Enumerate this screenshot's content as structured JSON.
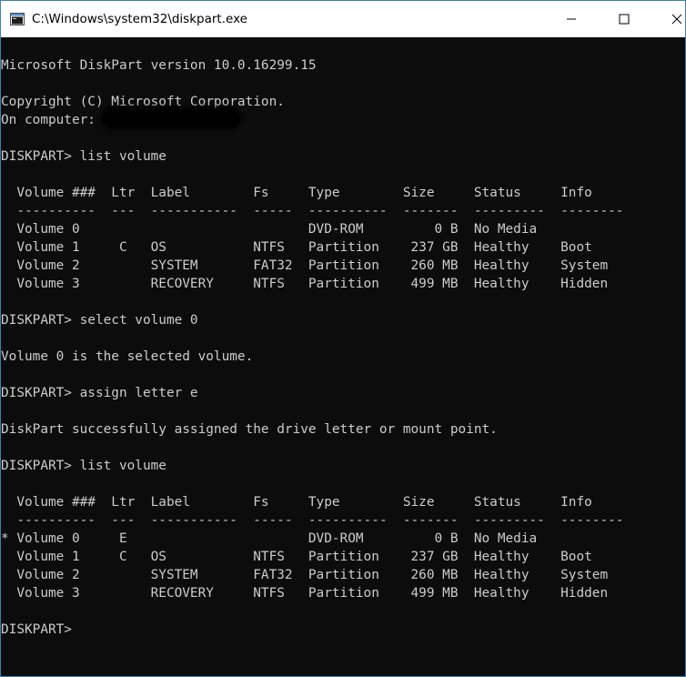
{
  "window": {
    "title": "C:\\Windows\\system32\\diskpart.exe"
  },
  "icons": {
    "app": "console-app-icon",
    "minimize": "minimize-icon",
    "maximize": "maximize-icon",
    "close": "close-icon"
  },
  "console": {
    "lines": [
      "Microsoft DiskPart version 10.0.16299.15",
      "",
      "Copyright (C) Microsoft Corporation.",
      "On computer: ",
      "",
      "DISKPART> list volume",
      "",
      "  Volume ###  Ltr  Label        Fs     Type        Size     Status     Info",
      "  ----------  ---  -----------  -----  ----------  -------  ---------  --------",
      "  Volume 0                             DVD-ROM         0 B  No Media",
      "  Volume 1     C   OS           NTFS   Partition    237 GB  Healthy    Boot",
      "  Volume 2         SYSTEM       FAT32  Partition    260 MB  Healthy    System",
      "  Volume 3         RECOVERY     NTFS   Partition    499 MB  Healthy    Hidden",
      "",
      "DISKPART> select volume 0",
      "",
      "Volume 0 is the selected volume.",
      "",
      "DISKPART> assign letter e",
      "",
      "DiskPart successfully assigned the drive letter or mount point.",
      "",
      "DISKPART> list volume",
      "",
      "  Volume ###  Ltr  Label        Fs     Type        Size     Status     Info",
      "  ----------  ---  -----------  -----  ----------  -------  ---------  --------",
      "* Volume 0     E                       DVD-ROM         0 B  No Media",
      "  Volume 1     C   OS           NTFS   Partition    237 GB  Healthy    Boot",
      "  Volume 2         SYSTEM       FAT32  Partition    260 MB  Healthy    System",
      "  Volume 3         RECOVERY     NTFS   Partition    499 MB  Healthy    Hidden",
      "",
      "DISKPART> "
    ]
  }
}
